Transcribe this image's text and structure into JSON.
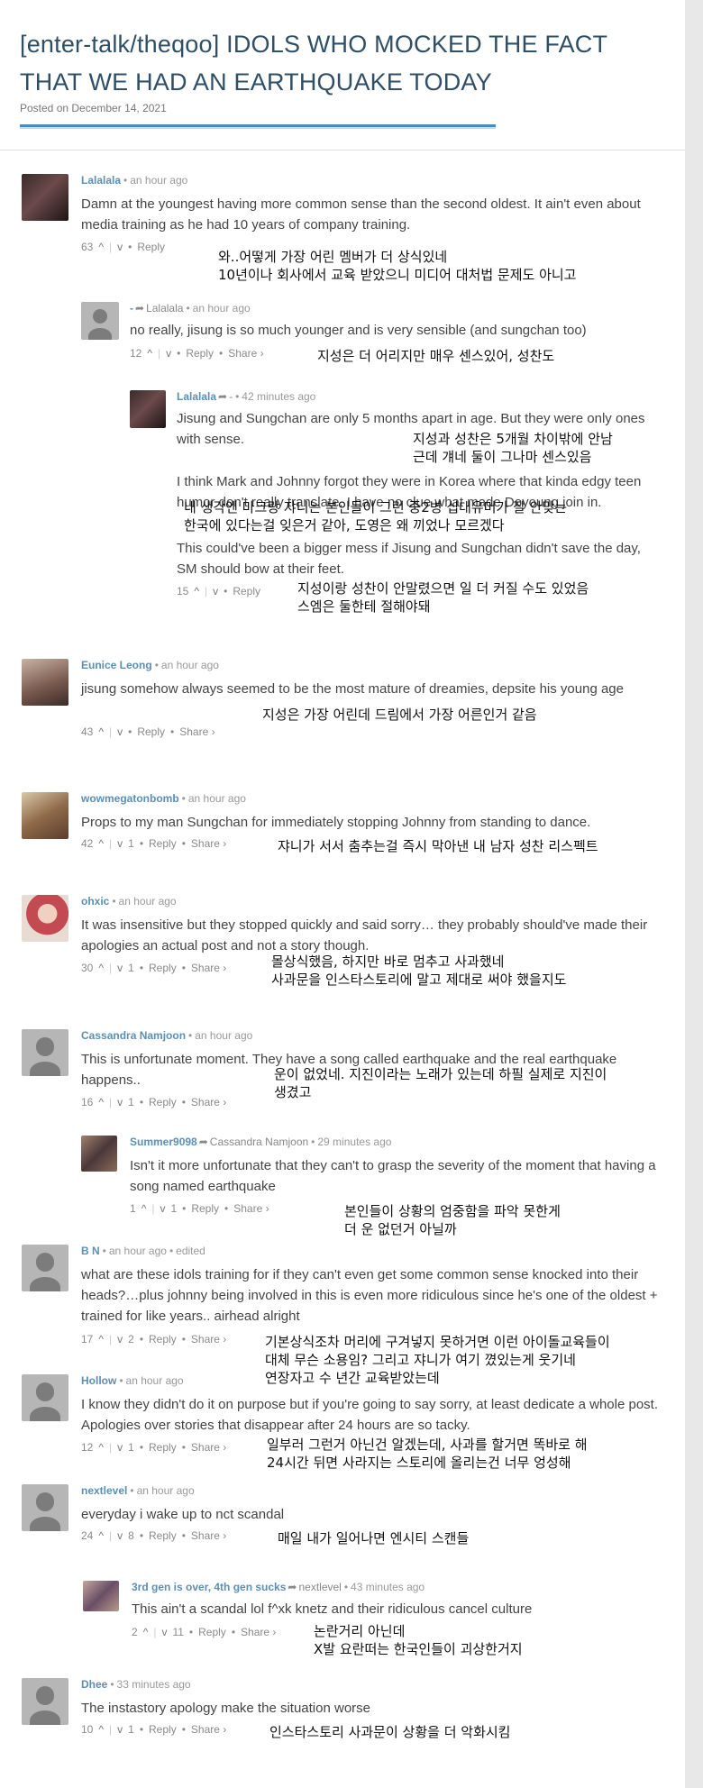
{
  "post": {
    "title": "[enter-talk/theqoo] IDOLS WHO MOCKED THE FACT THAT WE HAD AN EARTHQUAKE TODAY",
    "posted": "Posted on December 14, 2021"
  },
  "comments": [
    {
      "user": "Lalalala",
      "time": "an hour ago",
      "text": "Damn at the youngest having more common sense than the second oldest. It ain't even about media training as he had 10 years of company training.",
      "up": "63",
      "down": "",
      "reply": "Reply",
      "share": "",
      "ko": [
        "와..어떻게 가장 어린 멤버가 더 상식있네",
        "10년이나 회사에서 교육 받았으니 미디어 대처법 문제도 아니고"
      ]
    },
    {
      "user": "-",
      "to": "Lalalala",
      "time": "an hour ago",
      "text": "no really, jisung is so much younger and is very sensible (and sungchan too)",
      "up": "12",
      "down": "",
      "reply": "Reply",
      "share": "Share ›",
      "ko": [
        "지성은 더 어리지만 매우 센스있어, 성찬도"
      ]
    },
    {
      "user": "Lalalala",
      "to": "-",
      "time": "42 minutes ago",
      "text1": "Jisung and Sungchan are only 5 months apart in age. But they were only ones with sense.",
      "text2": "I think Mark and Johnny forgot they were in Korea where that kinda edgy teen humor don't really translate. I have no clue what made Doyoung join in.",
      "text3": "This could've been a bigger mess if Jisung and Sungchan didn't save the day, SM should bow at their feet.",
      "up": "15",
      "down": "",
      "reply": "Reply",
      "share": "",
      "ko1": [
        "지성과 성찬은 5개월 차이밖에 안남",
        "근데 걔네 둘이 그나마 센스있음"
      ],
      "ko2": [
        "내 생각엔 마크랑 쟈니는 본인들이 그런 중2병 십대유머가 잘 안맞는",
        "한국에 있다는걸 잊은거 같아, 도영은 왜 끼었나 모르겠다"
      ],
      "ko3": [
        "지성이랑 성찬이 안말렸으면 일 더 커질 수도 있었음",
        "스엠은 둘한테 절해야돼"
      ]
    },
    {
      "user": "Eunice Leong",
      "time": "an hour ago",
      "text": "jisung somehow always seemed to be the most mature of dreamies, depsite his young age",
      "up": "43",
      "down": "",
      "reply": "Reply",
      "share": "Share ›",
      "ko": [
        "지성은 가장 어린데 드림에서 가장 어른인거 같음"
      ]
    },
    {
      "user": "wowmegatonbomb",
      "time": "an hour ago",
      "text": "Props to my man Sungchan for immediately stopping Johnny from standing to dance.",
      "up": "42",
      "down": "1",
      "reply": "Reply",
      "share": "Share ›",
      "ko": [
        "쟈니가 서서 춤추는걸 즉시 막아낸 내 남자 성찬 리스펙트"
      ]
    },
    {
      "user": "ohxic",
      "time": "an hour ago",
      "text": "It was insensitive but they stopped quickly and said sorry… they probably should've made their apologies an actual post and not a story though.",
      "up": "30",
      "down": "1",
      "reply": "Reply",
      "share": "Share ›",
      "ko": [
        "몰상식했음, 하지만 바로 멈추고 사과했네",
        "사과문을 인스타스토리에 말고 제대로 써야 했을지도"
      ]
    },
    {
      "user": "Cassandra Namjoon",
      "time": "an hour ago",
      "text": "This is unfortunate moment. They have a song called earthquake and the real earthquake happens..",
      "up": "16",
      "down": "1",
      "reply": "Reply",
      "share": "Share ›",
      "ko": [
        "운이 없었네. 지진이라는 노래가 있는데 하필 실제로 지진이",
        "생겼고"
      ]
    },
    {
      "user": "Summer9098",
      "to": "Cassandra Namjoon",
      "time": "29 minutes ago",
      "text": "Isn't it more unfortunate that they can't to grasp the severity of the moment that having a song named earthquake",
      "up": "1",
      "down": "1",
      "reply": "Reply",
      "share": "Share ›",
      "ko": [
        "본인들이 상황의 엄중함을 파악 못한게",
        "더 운 없던거 아닐까"
      ]
    },
    {
      "user": "B N",
      "time": "an hour ago",
      "edited": "edited",
      "text": "what are these idols training for if they can't even get some common sense knocked into their heads?…plus johnny being involved in this is even more ridiculous since he's one of the oldest + trained for like years.. airhead alright",
      "up": "17",
      "down": "2",
      "reply": "Reply",
      "share": "Share ›",
      "ko": [
        "기본상식조차 머리에 구겨넣지 못하거면 이런 아이돌교육들이",
        "대체 무슨 소용임? 그리고 쟈니가 여기 꼈있는게 웃기네",
        "연장자고 수 년간 교육받았는데"
      ]
    },
    {
      "user": "Hollow",
      "time": "an hour ago",
      "text": "I know they didn't do it on purpose but if you're going to say sorry, at least dedicate a whole post. Apologies over stories that disappear after 24 hours are so tacky.",
      "up": "12",
      "down": "1",
      "reply": "Reply",
      "share": "Share ›",
      "ko": [
        "일부러 그런거 아닌건 알겠는데, 사과를 할거면 똑바로 해",
        "24시간 뒤면 사라지는 스토리에 올리는건 너무 엉성해"
      ]
    },
    {
      "user": "nextlevel",
      "time": "an hour ago",
      "text": "everyday i wake up to nct scandal",
      "up": "24",
      "down": "8",
      "reply": "Reply",
      "share": "Share ›",
      "ko": [
        "매일 내가 일어나면 엔시티 스캔들"
      ]
    },
    {
      "user": "3rd gen is over, 4th gen sucks",
      "to": "nextlevel",
      "time": "43 minutes ago",
      "text": "This ain't a scandal lol f^xk knetz and their ridiculous cancel culture",
      "up": "2",
      "down": "11",
      "reply": "Reply",
      "share": "Share ›",
      "ko": [
        "논란거리 아닌데",
        "X발 요란떠는 한국인들이 괴상한거지"
      ]
    },
    {
      "user": "Dhee",
      "time": "33 minutes ago",
      "text": "The instastory apology make the situation worse",
      "up": "10",
      "down": "1",
      "reply": "Reply",
      "share": "Share ›",
      "ko": [
        "인스타스토리 사과문이 상황을 더 악화시킴"
      ]
    }
  ]
}
